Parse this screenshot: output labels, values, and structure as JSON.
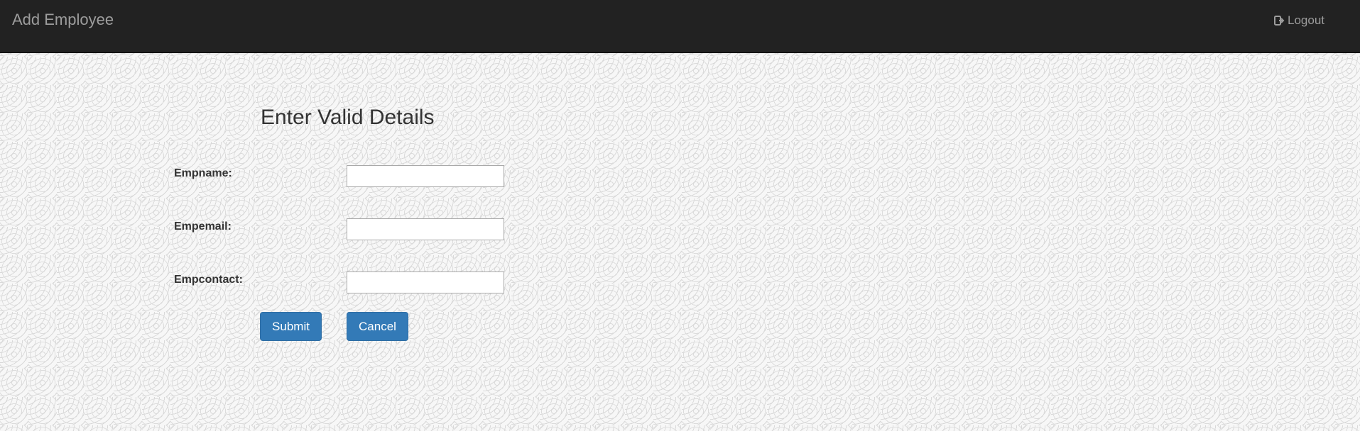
{
  "navbar": {
    "brand": "Add Employee",
    "logout_label": "Logout"
  },
  "form": {
    "title": "Enter Valid Details",
    "fields": [
      {
        "label": "Empname:",
        "value": "",
        "placeholder": ""
      },
      {
        "label": "Empemail:",
        "value": "",
        "placeholder": ""
      },
      {
        "label": "Empcontact:",
        "value": "",
        "placeholder": ""
      }
    ],
    "submit_label": "Submit",
    "cancel_label": "Cancel"
  },
  "colors": {
    "navbar_bg": "#222222",
    "navbar_text": "#9d9d9d",
    "button_primary": "#337ab7"
  },
  "icons": {
    "logout": "log-out-icon"
  }
}
